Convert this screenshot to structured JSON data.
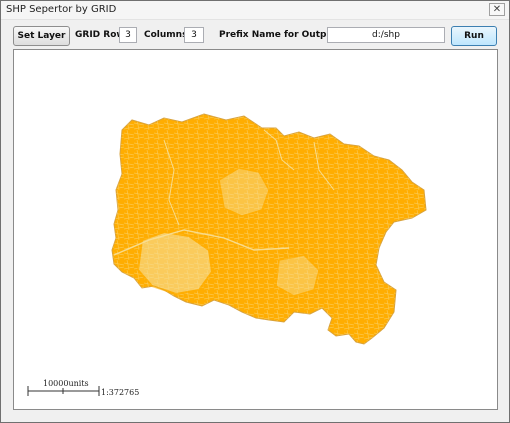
{
  "window": {
    "title": "SHP Sepertor by GRID",
    "close_glyph": "✕"
  },
  "toolbar": {
    "set_layer_label": "Set Layer",
    "grid_rows_label": "GRID Rows",
    "grid_rows_value": "3",
    "columns_label": "Columns",
    "columns_value": "3",
    "prefix_label": "Prefix Name for Output Files",
    "prefix_value": "d:/shp",
    "run_label": "Run"
  },
  "map": {
    "fill_color": "#ffad00",
    "light_fill_color": "#f7e09a",
    "border_color": "#d8a23c",
    "scale_label": "10000units",
    "scale_ratio": "1:372765"
  }
}
